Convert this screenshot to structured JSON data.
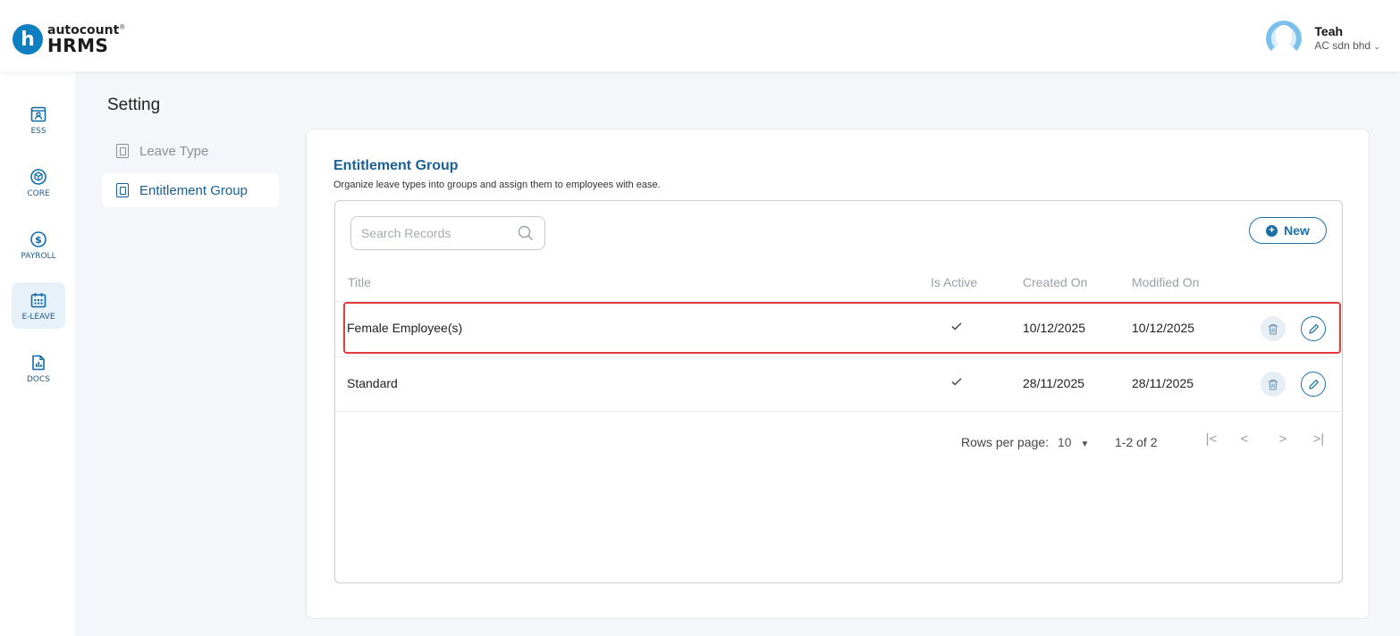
{
  "app": {
    "logo_letter": "h",
    "logo_small": "autocount",
    "logo_big": "HRMS"
  },
  "user": {
    "name": "Teah",
    "company": "AC sdn bhd"
  },
  "sidebar": {
    "items": [
      {
        "label": "ESS",
        "icon": "ess-icon",
        "active": false
      },
      {
        "label": "CORE",
        "icon": "core-cube-icon",
        "active": false
      },
      {
        "label": "PAYROLL",
        "icon": "dollar-icon",
        "active": false
      },
      {
        "label": "E-LEAVE",
        "icon": "calendar-icon",
        "active": true
      },
      {
        "label": "DOCS",
        "icon": "document-chart-icon",
        "active": false
      }
    ]
  },
  "settings": {
    "title": "Setting",
    "nav": [
      {
        "label": "Leave Type",
        "active": false
      },
      {
        "label": "Entitlement Group",
        "active": true
      }
    ]
  },
  "main": {
    "title": "Entitlement Group",
    "description": "Organize leave types into groups and assign them to employees with ease.",
    "search_placeholder": "Search Records",
    "new_label": "New",
    "columns": {
      "title": "Title",
      "is_active": "Is Active",
      "created_on": "Created On",
      "modified_on": "Modified On"
    },
    "rows": [
      {
        "title": "Female Employee(s)",
        "is_active": true,
        "created_on": "10/12/2025",
        "modified_on": "10/12/2025",
        "highlighted": true
      },
      {
        "title": "Standard",
        "is_active": true,
        "created_on": "28/11/2025",
        "modified_on": "28/11/2025",
        "highlighted": false
      }
    ],
    "pagination": {
      "rows_per_page_label": "Rows per page:",
      "rows_per_page_value": "10",
      "range": "1-2 of 2"
    }
  },
  "colors": {
    "brand": "#0f7fc1",
    "accent": "#1b6fa8",
    "highlight": "#e23b3b"
  }
}
